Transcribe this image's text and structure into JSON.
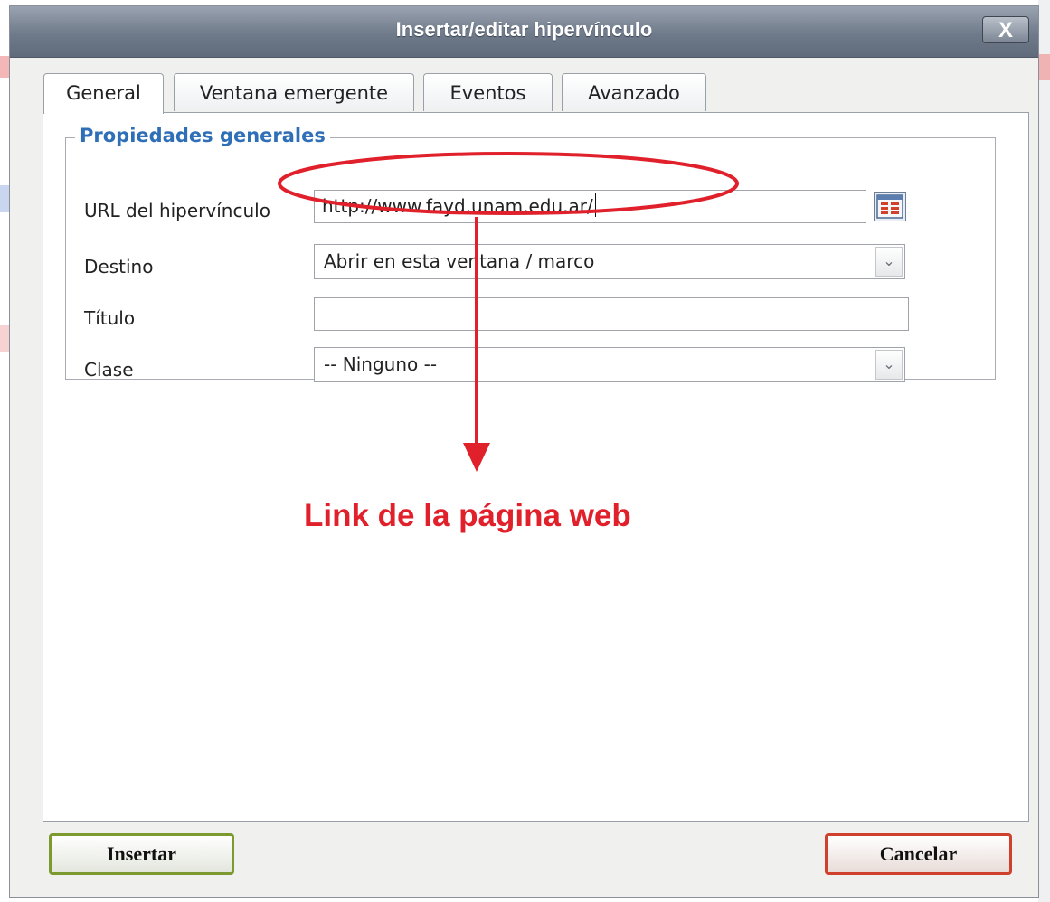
{
  "dialog": {
    "title": "Insertar/editar hipervínculo",
    "close_label": "X"
  },
  "tabs": [
    {
      "label": "General",
      "active": true
    },
    {
      "label": "Ventana emergente",
      "active": false
    },
    {
      "label": "Eventos",
      "active": false
    },
    {
      "label": "Avanzado",
      "active": false
    }
  ],
  "general": {
    "legend": "Propiedades generales",
    "url_label": "URL del hipervínculo",
    "url_value": "http://www.fayd.unam.edu.ar/",
    "target_label": "Destino",
    "target_value": "Abrir en esta ventana / marco",
    "title_label": "Título",
    "title_value": "",
    "class_label": "Clase",
    "class_value": "-- Ninguno --"
  },
  "annotation": {
    "text": "Link de la página web",
    "color": "#e0202a"
  },
  "buttons": {
    "insert": "Insertar",
    "cancel": "Cancelar"
  },
  "icons": {
    "browse": "link-list-icon",
    "dropdown": "chevron-down-icon"
  },
  "colors": {
    "legend": "#2f6fb7",
    "insert_border": "#7c9a2f",
    "cancel_border": "#d0412d"
  }
}
